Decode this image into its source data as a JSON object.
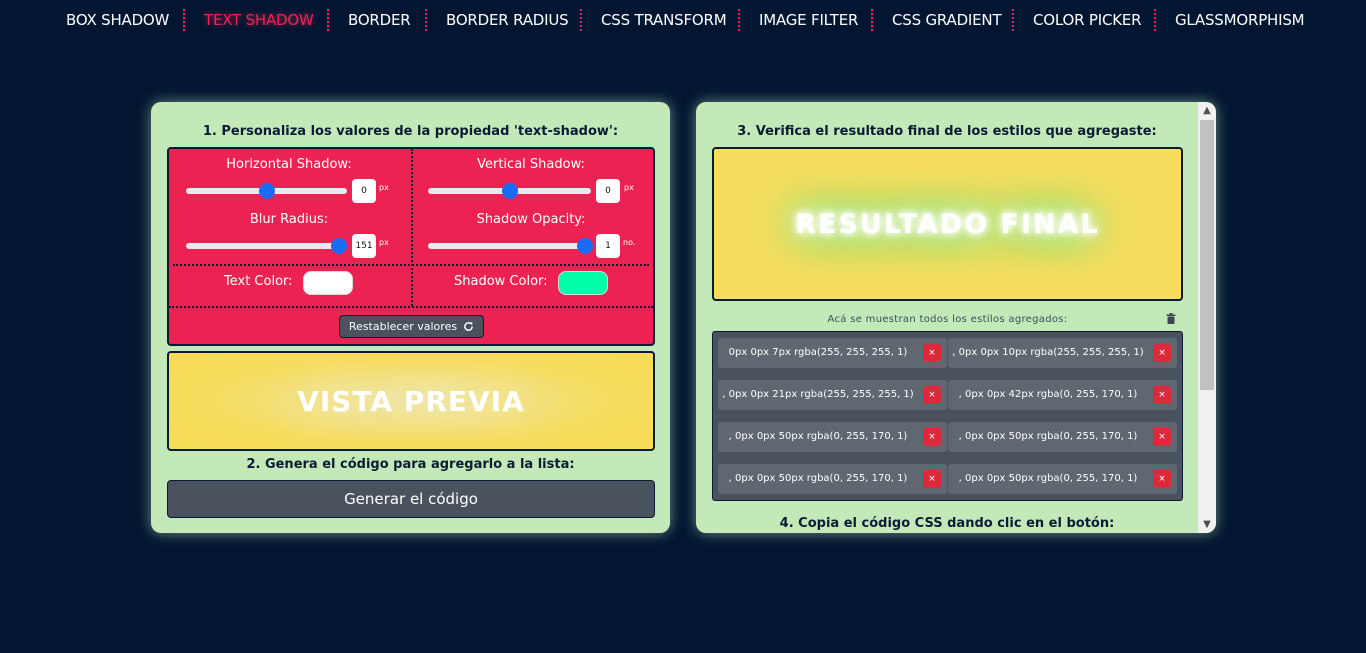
{
  "nav": {
    "items": [
      "BOX SHADOW",
      "TEXT SHADOW",
      "BORDER",
      "BORDER RADIUS",
      "CSS TRANSFORM",
      "IMAGE FILTER",
      "CSS GRADIENT",
      "COLOR PICKER",
      "GLASSMORPHISM"
    ],
    "active": "TEXT SHADOW"
  },
  "left": {
    "title": "1. Personaliza los valores de la propiedad 'text-shadow':",
    "horizontal": {
      "label": "Horizontal Shadow:",
      "value": "0",
      "unit": "px",
      "level": 0.5
    },
    "vertical": {
      "label": "Vertical Shadow:",
      "value": "0",
      "unit": "px",
      "level": 0.5
    },
    "blur": {
      "label": "Blur Radius:",
      "value": "151",
      "unit": "px",
      "level": 0.95
    },
    "opacity": {
      "label": "Shadow Opacity:",
      "value": "1",
      "unit": "no.",
      "level": 1.0
    },
    "text_color": {
      "label": "Text Color:",
      "color": "#ffffff"
    },
    "shadow_color": {
      "label": "Shadow Color:",
      "color": "#00ffaa"
    },
    "reset_label": "Restablecer valores",
    "reset_icon": "refresh-icon",
    "preview_text": "VISTA PREVIA",
    "generate_title": "2. Genera el código para agregarlo a la lista:",
    "generate_label": "Generar el código"
  },
  "right": {
    "title": "3. Verifica el resultado final de los estilos que agregaste:",
    "result_text": "RESULTADO FINAL",
    "styles_caption": "Acá se muestran todos los estilos agregados:",
    "trash_icon": "trash-icon",
    "styles": [
      "0px 0px 7px rgba(255, 255, 255, 1)",
      ", 0px 0px 10px rgba(255, 255, 255, 1)",
      ", 0px 0px 21px rgba(255, 255, 255, 1)",
      ", 0px 0px 42px rgba(0, 255, 170, 1)",
      ", 0px 0px 50px rgba(0, 255, 170, 1)",
      ", 0px 0px 50px rgba(0, 255, 170, 1)",
      ", 0px 0px 50px rgba(0, 255, 170, 1)",
      ", 0px 0px 50px rgba(0, 255, 170, 1)"
    ],
    "remove_label": "×",
    "copy_title": "4. Copia el código CSS dando clic en el botón:"
  },
  "colors": {
    "background": "#021631",
    "accent": "#ec2352",
    "panel": "#c3e9b9",
    "preview_bg": "#f6dd5e",
    "slider_thumb": "#1a6cf5"
  }
}
